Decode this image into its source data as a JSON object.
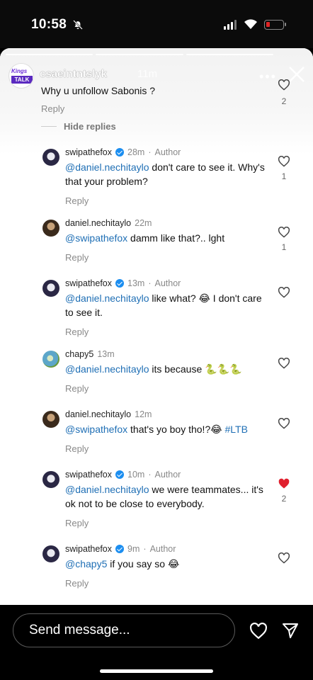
{
  "status_bar": {
    "time": "10:58"
  },
  "story": {
    "username_overlay": "csaeintntslyk",
    "age": "11m",
    "logo_top": "Kings",
    "logo_bottom": "TALK"
  },
  "parent_comment": {
    "text": "Why u unfollow Sabonis ?",
    "reply_label": "Reply",
    "like_count": "2"
  },
  "hide_replies_label": "Hide replies",
  "replies": [
    {
      "user": "swipathefox",
      "verified": true,
      "time": "28m",
      "author_label": "Author",
      "mention": "@daniel.nechitaylo",
      "text": " don't care to see it. Why's that your problem?",
      "reply_label": "Reply",
      "like_count": "1",
      "liked": false
    },
    {
      "user": "daniel.nechitaylo",
      "verified": false,
      "time": "22m",
      "author_label": "",
      "mention": "@swipathefox",
      "text": " damm like that?.. lght",
      "reply_label": "Reply",
      "like_count": "1",
      "liked": false
    },
    {
      "user": "swipathefox",
      "verified": true,
      "time": "13m",
      "author_label": "Author",
      "mention": "@daniel.nechitaylo",
      "text": " like what? 😂 I don't care to see it.",
      "reply_label": "Reply",
      "like_count": "",
      "liked": false
    },
    {
      "user": "chapy5",
      "verified": false,
      "time": "13m",
      "author_label": "",
      "mention": "@daniel.nechitaylo",
      "text": " its because 🐍🐍🐍",
      "reply_label": "Reply",
      "like_count": "",
      "liked": false
    },
    {
      "user": "daniel.nechitaylo",
      "verified": false,
      "time": "12m",
      "author_label": "",
      "mention": "@swipathefox",
      "text": " that's yo boy tho!?😂 ",
      "tag": "#LTB",
      "reply_label": "Reply",
      "like_count": "",
      "liked": false
    },
    {
      "user": "swipathefox",
      "verified": true,
      "time": "10m",
      "author_label": "Author",
      "mention": "@daniel.nechitaylo",
      "text": " we were teammates... it's ok not to be close to everybody.",
      "reply_label": "Reply",
      "like_count": "2",
      "liked": true
    },
    {
      "user": "swipathefox",
      "verified": true,
      "time": "9m",
      "author_label": "Author",
      "mention": "@chapy5",
      "text": " if you say so 😂",
      "reply_label": "Reply",
      "like_count": "",
      "liked": false
    }
  ],
  "bottom": {
    "message_placeholder": "Send message..."
  },
  "colors": {
    "link": "#1f6fb5",
    "verified": "#1c8ef0",
    "liked_heart": "#e0202e"
  }
}
